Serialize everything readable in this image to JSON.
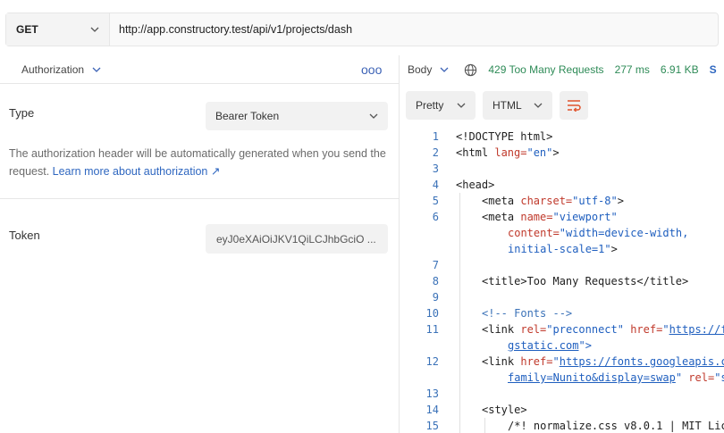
{
  "request": {
    "method": "GET",
    "url": "http://app.constructory.test/api/v1/projects/dash"
  },
  "auth": {
    "tab_label": "Authorization",
    "more_label": "ooo",
    "type_label": "Type",
    "type_value": "Bearer Token",
    "info_text": "The authorization header will be automatically generated when you send the request.",
    "info_link": "Learn more about authorization ↗",
    "token_label": "Token",
    "token_value": "eyJ0eXAiOiJKV1QiLCJhbGciO ..."
  },
  "response": {
    "body_tab": "Body",
    "status": "429 Too Many Requests",
    "time": "277 ms",
    "size": "6.91 KB",
    "save_label": "S",
    "format_label": "Pretty",
    "language_label": "HTML"
  },
  "code_lines": {
    "l1": "<!DOCTYPE html>",
    "l2a": "<html ",
    "l2b": "lang=",
    "l2c": "\"en\"",
    "l2d": ">",
    "l4": "<head>",
    "l5a": "<meta ",
    "l5b": "charset=",
    "l5c": "\"utf-8\"",
    "l5d": ">",
    "l6a": "<meta ",
    "l6b": "name=",
    "l6c": "\"viewport\"",
    "l6e": "content=",
    "l6f": "\"width=device-width,",
    "l6g": "initial-scale=1\"",
    "l6h": ">",
    "l8": "<title>Too Many Requests</title>",
    "l10": "<!-- Fonts -->",
    "l11a": "<link ",
    "l11b": "rel=",
    "l11c": "\"preconnect\"",
    "l11d": " href=",
    "l11e": "\"",
    "l11f": "https://f",
    "l11g": "gstatic.com",
    "l11h": "\">",
    "l12a": "<link ",
    "l12b": "href=",
    "l12c": "\"",
    "l12d": "https://fonts.googleapis.c",
    "l12e": "family=Nunito&display=swap",
    "l12f": "\"",
    "l12g": " rel=",
    "l12h": "\"s",
    "l14": "<style>",
    "l15": "/*! normalize.css v8.0.1 | MIT Lic"
  },
  "line_numbers": [
    "1",
    "2",
    "3",
    "4",
    "5",
    "6",
    "7",
    "8",
    "9",
    "10",
    "11",
    "12",
    "13",
    "14",
    "15"
  ],
  "colors": {
    "status_green": "#2e8b57",
    "link_blue": "#2f67c0",
    "attr_red": "#c0392b",
    "line_number_blue": "#3b72b8"
  }
}
